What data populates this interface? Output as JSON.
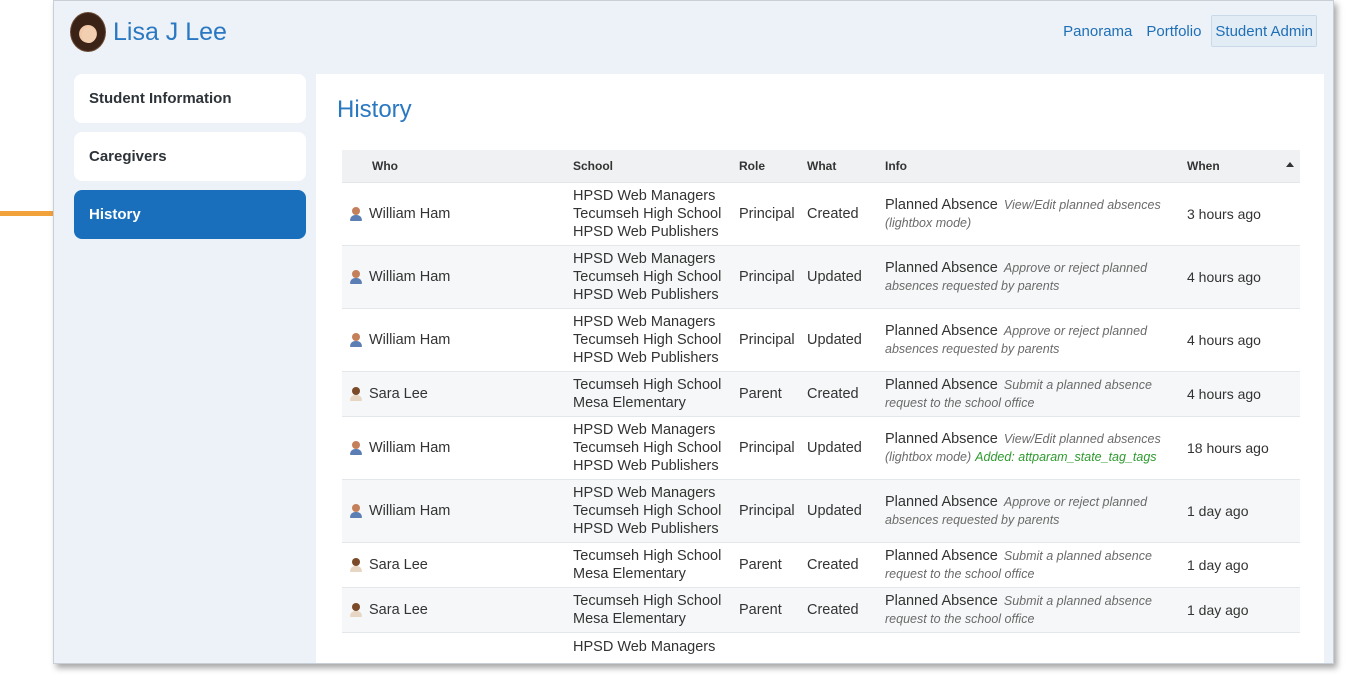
{
  "header": {
    "student_name": "Lisa J Lee"
  },
  "topnav": [
    {
      "label": "Panorama",
      "active": false
    },
    {
      "label": "Portfolio",
      "active": false
    },
    {
      "label": "Student Admin",
      "active": true
    }
  ],
  "sidebar": {
    "items": [
      {
        "label": "Student Information",
        "active": false
      },
      {
        "label": "Caregivers",
        "active": false
      },
      {
        "label": "History",
        "active": true
      }
    ]
  },
  "main": {
    "title": "History",
    "columns": {
      "who": "Who",
      "school": "School",
      "role": "Role",
      "what": "What",
      "info": "Info",
      "when": "When"
    },
    "rows": [
      {
        "who": "William Ham",
        "icon": "male-user-icon",
        "schools": [
          "HPSD Web Managers",
          "Tecumseh High School",
          "HPSD Web Publishers"
        ],
        "role": "Principal",
        "what": "Created",
        "info_title": "Planned Absence",
        "info_desc": "View/Edit planned absences (lightbox mode)",
        "info_added": "",
        "when": "3 hours ago"
      },
      {
        "who": "William Ham",
        "icon": "male-user-icon",
        "schools": [
          "HPSD Web Managers",
          "Tecumseh High School",
          "HPSD Web Publishers"
        ],
        "role": "Principal",
        "what": "Updated",
        "info_title": "Planned Absence",
        "info_desc": "Approve or reject planned absences requested by parents",
        "info_added": "",
        "when": "4 hours ago"
      },
      {
        "who": "William Ham",
        "icon": "male-user-icon",
        "schools": [
          "HPSD Web Managers",
          "Tecumseh High School",
          "HPSD Web Publishers"
        ],
        "role": "Principal",
        "what": "Updated",
        "info_title": "Planned Absence",
        "info_desc": "Approve or reject planned absences requested by parents",
        "info_added": "",
        "when": "4 hours ago"
      },
      {
        "who": "Sara Lee",
        "icon": "female-user-icon",
        "schools": [
          "Tecumseh High School",
          "Mesa Elementary"
        ],
        "role": "Parent",
        "what": "Created",
        "info_title": "Planned Absence",
        "info_desc": "Submit a planned absence request to the school office",
        "info_added": "",
        "when": "4 hours ago"
      },
      {
        "who": "William Ham",
        "icon": "male-user-icon",
        "schools": [
          "HPSD Web Managers",
          "Tecumseh High School",
          "HPSD Web Publishers"
        ],
        "role": "Principal",
        "what": "Updated",
        "info_title": "Planned Absence",
        "info_desc": "View/Edit planned absences (lightbox mode)",
        "info_added": "Added: attparam_state_tag_tags",
        "when": "18 hours ago"
      },
      {
        "who": "William Ham",
        "icon": "male-user-icon",
        "schools": [
          "HPSD Web Managers",
          "Tecumseh High School",
          "HPSD Web Publishers"
        ],
        "role": "Principal",
        "what": "Updated",
        "info_title": "Planned Absence",
        "info_desc": "Approve or reject planned absences requested by parents",
        "info_added": "",
        "when": "1 day ago"
      },
      {
        "who": "Sara Lee",
        "icon": "female-user-icon",
        "schools": [
          "Tecumseh High School",
          "Mesa Elementary"
        ],
        "role": "Parent",
        "what": "Created",
        "info_title": "Planned Absence",
        "info_desc": "Submit a planned absence request to the school office",
        "info_added": "",
        "when": "1 day ago"
      },
      {
        "who": "Sara Lee",
        "icon": "female-user-icon",
        "schools": [
          "Tecumseh High School",
          "Mesa Elementary"
        ],
        "role": "Parent",
        "what": "Created",
        "info_title": "Planned Absence",
        "info_desc": "Submit a planned absence request to the school office",
        "info_added": "",
        "when": "1 day ago"
      },
      {
        "who": "",
        "icon": "",
        "schools": [
          "HPSD Web Managers"
        ],
        "role": "",
        "what": "",
        "info_title": "",
        "info_desc": "",
        "info_added": "",
        "when": ""
      }
    ]
  },
  "help": {
    "label": "?"
  },
  "colors": {
    "accent": "#1a6fbd",
    "link": "#2a78c2",
    "callout_arrow": "#f2a23a",
    "added_text": "#2e9a2e"
  }
}
